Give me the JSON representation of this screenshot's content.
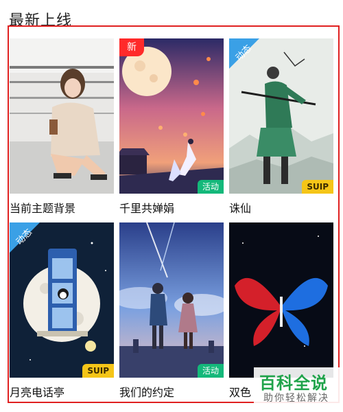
{
  "section": {
    "title": "最新上线"
  },
  "cards": [
    {
      "label": "当前主题背景"
    },
    {
      "label": "千里共婵娟",
      "badge_new": "新",
      "tag": "活动"
    },
    {
      "label": "诛仙",
      "badge_corner": "动态",
      "tag": "SUIP"
    },
    {
      "label": "月亮电话亭",
      "badge_corner": "动态",
      "tag": "SUIP"
    },
    {
      "label": "我们的约定",
      "tag": "活动"
    },
    {
      "label": "双色"
    }
  ],
  "watermark": {
    "main": "百科全说",
    "sub": "助你轻松解决"
  },
  "colors": {
    "new_badge": "#ff2a2a",
    "dynamic_badge": "#3aa0e6",
    "activity_tag": "#14b87a",
    "suip_tag": "#f5c518",
    "frame": "#e02020"
  }
}
